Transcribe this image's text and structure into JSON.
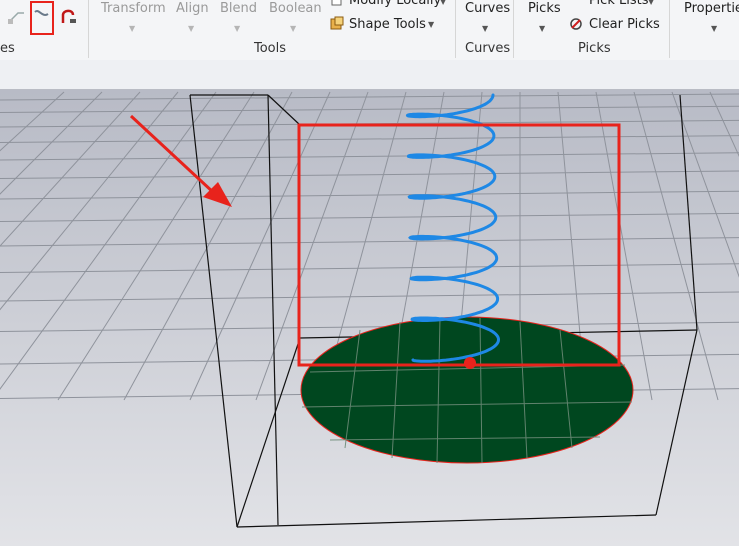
{
  "ribbon": {
    "left_group_label": "es",
    "tools": {
      "transform": "Transform",
      "align": "Align",
      "blend": "Blend",
      "boolean": "Boolean",
      "modify_locally": "Modify Locally",
      "shape_tools": "Shape Tools",
      "group_label": "Tools"
    },
    "curves": {
      "button": "Curves",
      "group_label": "Curves"
    },
    "picks": {
      "button": "Picks",
      "pick_lists": "Pick Lists",
      "clear_picks": "Clear Picks",
      "group_label": "Picks"
    },
    "properties": {
      "button": "Properties"
    }
  },
  "colors": {
    "annotation_red": "#e8231c",
    "helix_blue": "#1e88e5",
    "disk_green": "#00471f",
    "grid_line": "#8f939c",
    "background": "#c9cbd3"
  },
  "icons": [
    "edge-tool-icon",
    "curve-tool-icon",
    "fillet-tool-icon",
    "modify-locally-icon",
    "shape-tools-icon",
    "clear-picks-icon"
  ]
}
